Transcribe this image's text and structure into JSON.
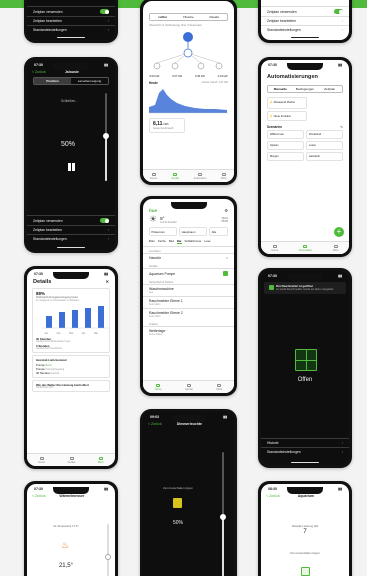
{
  "colors": {
    "brand": "#4fba3c",
    "dark_bg": "#0e0e0e",
    "page_bg": "#f2f3f2"
  },
  "status_time": "07:30",
  "p1": {
    "rows": [
      "Zeitplan verwenden",
      "Zeitplan bearbeiten",
      "Standardeinstellungen"
    ]
  },
  "p2": {
    "tabs": [
      "Lüfter",
      "Historie",
      "Details"
    ],
    "note": "Übersicht (1 Verbindung) über 2 Sekunden",
    "stats": [
      "5.00 kW",
      "0.07 kW",
      "0.35 kW",
      "0.34 kW"
    ],
    "chart_title": "Heute",
    "chart_sub": "Letzter Stand: 1,47 kW",
    "energy_value": "8,11",
    "energy_unit": "kWh",
    "energy_label": "Gesamtverbrauch",
    "tab_labels": [
      "Home",
      "Geräte",
      "Automation",
      "Mehr"
    ]
  },
  "p3": {
    "rows": [
      "Zeitplan verwenden",
      "Zeitplan bearbeiten",
      "Standardeinstellungen"
    ]
  },
  "p4": {
    "back": "< Zurück",
    "title": "Jalousie",
    "seg": [
      "Position",
      "Lamellenneigung"
    ],
    "state": "Schließen...",
    "percent": "50%",
    "rows": [
      "Zeitplan verwenden",
      "Zeitplan bearbeiten",
      "Standardeinstellungen"
    ]
  },
  "p5": {
    "logo": "hue",
    "temp": "8°",
    "weather": "Leicht bewölkt",
    "t1": "18:12",
    "t2": "08:06",
    "tiles": [
      "Präsenzen",
      "Hauptraum",
      "Alle"
    ],
    "tabs": [
      "Büro",
      "Küche",
      "Bad",
      "Bar",
      "Schlafzimmer",
      "Lese"
    ],
    "sections": [
      "Leuchten",
      "Geräte",
      "Sicherheit & Schutz",
      "Andere"
    ],
    "items": [
      "Haustür",
      "Aquarium Pumpe",
      "Waschmaschine",
      "Rauchmelder Ebene 1",
      "Rauchmelder Ebene 2",
      "Wetterlage"
    ],
    "subs": [
      "",
      "",
      "Aus",
      "Kein Alarm",
      "Kein Alarm",
      "Keine Daten"
    ]
  },
  "p6": {
    "title": "Automatisierungen",
    "seg": [
      "Manuelle",
      "Bedingungen",
      "Zeitplan"
    ],
    "cards": [
      "Abwesend Modus",
      "Neue Funktion"
    ],
    "section": "Szenarien",
    "scenes": [
      "Willkommen",
      "Filmabend",
      "Spielen",
      "Lesen",
      "Morgen",
      "Heimkehr",
      "Abend",
      "Abwesenheit"
    ]
  },
  "p7": {
    "title": "Details",
    "percent": "88%",
    "desc": "Zielbereich Energieerzeugung heute",
    "desc2": "Im Vergleich zu Vormonaten im Zeitraum",
    "bar_labels": [
      "Jan",
      "Feb",
      "Mär",
      "Apr",
      "Mai"
    ],
    "b1": "32 Stunden",
    "b1s": "Laufzeit durch Bewusstsein heute",
    "b2": "3 Stunden",
    "b2s": "Laufzeit durch Ausnahme",
    "section": "Heizstab Lieferzustand",
    "r1": "Pumpe",
    "r1s": "Bereit",
    "r2": "Pumpe",
    "r2s": "Heizungsregelung",
    "r3": "30 Stunden",
    "r3s": "Laufzeit",
    "q": "Wie das Weller Rox Heizung kontrolliert",
    "qs": "Funktioniert nicht"
  },
  "p8": {
    "app": "Rox Rauchmelder ist geöffnet",
    "msg": "Im Gerät Rauchmelder wurde ein Alarm ausgelöst",
    "status": "Offen",
    "rows": [
      "Historie",
      "Standardeinstellungen"
    ]
  },
  "p9": {
    "time": "09:03",
    "back": "< Zurück",
    "title": "Dimmerleuchte",
    "hint": "Zum Ausschalten tippen",
    "percent": "50%"
  },
  "p10": {
    "time": "07:30",
    "back": "< Zurück",
    "title": "Wärmelmesser",
    "temp_label": "Ist-Temperatur 17,6°",
    "temp": "21,5°"
  },
  "p11": {
    "time": "08:30",
    "back": "< Zurück",
    "title": "Aquarium",
    "label": "Aktuelle Leistung (W)",
    "value": "7",
    "hint": "Zum Ausschalten tippen"
  }
}
